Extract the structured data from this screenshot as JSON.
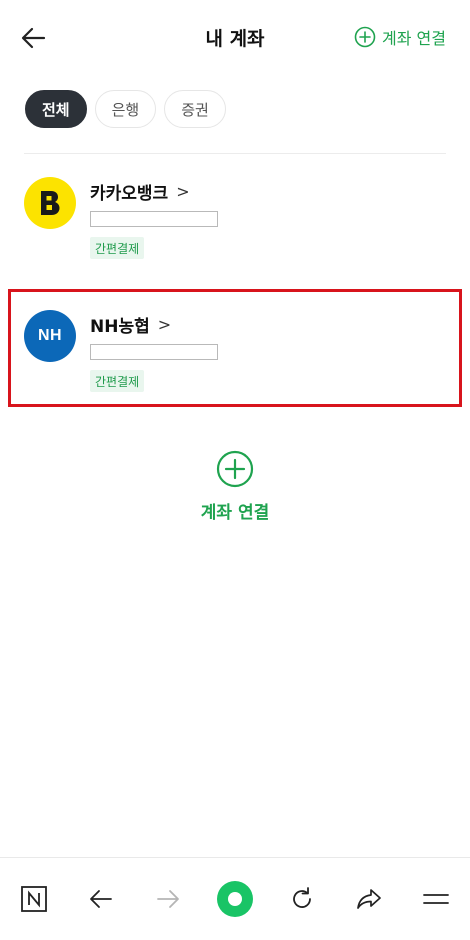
{
  "header": {
    "title": "내 계좌",
    "link_label": "계좌 연결",
    "back_icon": "arrow-left-icon",
    "add_icon": "plus-circle-icon"
  },
  "filters": [
    {
      "label": "전체",
      "active": true
    },
    {
      "label": "은행",
      "active": false
    },
    {
      "label": "증권",
      "active": false
    }
  ],
  "accounts": [
    {
      "name": "카카오뱅크",
      "logo_text": "B",
      "badge": "간편결제",
      "logo_color": "#fce300"
    },
    {
      "name": "NH농협",
      "logo_text": "NH",
      "badge": "간편결제",
      "logo_color": "#0c68b8"
    }
  ],
  "add_account": {
    "label": "계좌 연결"
  },
  "colors": {
    "accent": "#1fa34f",
    "highlight": "#d8141c",
    "chip_active": "#2c3138"
  },
  "bottom_nav": [
    {
      "icon": "naver-home-icon"
    },
    {
      "icon": "back-arrow-icon"
    },
    {
      "icon": "forward-arrow-icon"
    },
    {
      "icon": "green-dot-icon"
    },
    {
      "icon": "refresh-icon"
    },
    {
      "icon": "share-icon"
    },
    {
      "icon": "menu-icon"
    }
  ]
}
